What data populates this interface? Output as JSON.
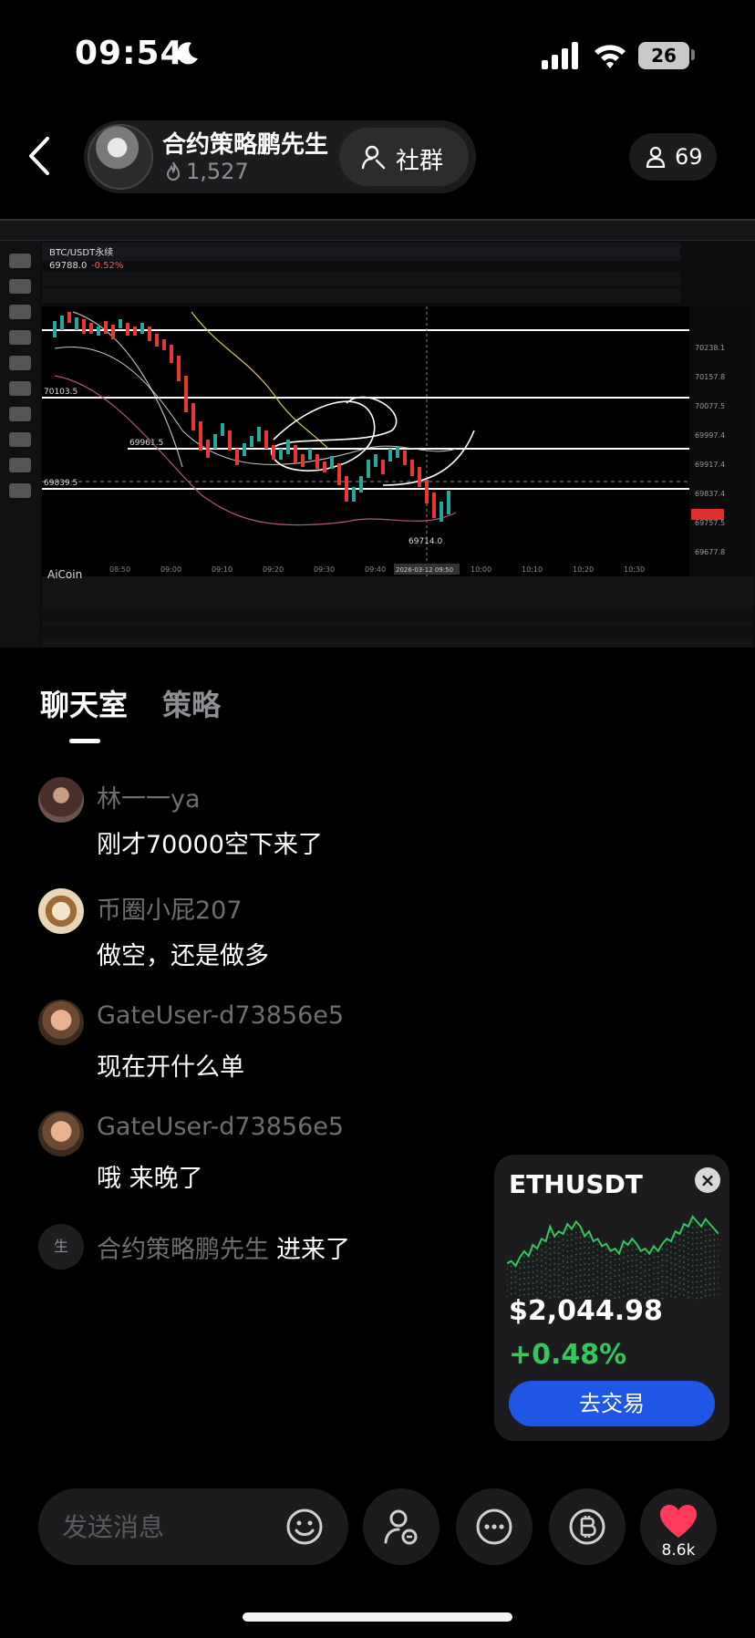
{
  "status_bar": {
    "time": "09:54",
    "battery": "26"
  },
  "header": {
    "host_name": "合约策略鹏先生",
    "host_heat": "1,527",
    "group_label": "社群",
    "viewer_count": "69"
  },
  "chart": {
    "pair": "BTC/USDT永续",
    "last_price": "69788.0",
    "change": "-0.52%",
    "levels": [
      "70103.5",
      "69961.5",
      "69839.5",
      "69714.0"
    ],
    "right_axis": [
      "70238.1",
      "70157.8",
      "70077.5",
      "69997.4",
      "69917.4",
      "69837.4",
      "69757.5",
      "69677.8"
    ],
    "time_labels": [
      "08:50",
      "09:00",
      "09:10",
      "09:20",
      "09:30",
      "09:40",
      "10:00",
      "10:10",
      "10:20",
      "10:30"
    ],
    "cursor_time": "2026-03-12 09:50",
    "brand": "AiCoin"
  },
  "tabs": {
    "chat": "聊天室",
    "strategy": "策略"
  },
  "messages": [
    {
      "user": "林一一ya",
      "text": "刚才70000空下来了"
    },
    {
      "user": "币圈小屁207",
      "text": "做空，还是做多"
    },
    {
      "user": "GateUser-d73856e5",
      "text": "现在开什么单"
    },
    {
      "user": "GateUser-d73856e5",
      "text": "哦 来晚了"
    }
  ],
  "system_message": {
    "avatar_char": "生",
    "user": "合约策略鹏先生",
    "action": "进来了"
  },
  "ticker": {
    "symbol": "ETHUSDT",
    "price": "$2,044.98",
    "change": "+0.48%",
    "button": "去交易",
    "sparkline": [
      40,
      42,
      38,
      45,
      50,
      46,
      55,
      52,
      60,
      58,
      70,
      62,
      66,
      64,
      72,
      68,
      74,
      70,
      62,
      66,
      58,
      60,
      54,
      56,
      50,
      52,
      48,
      58,
      55,
      60,
      56,
      50,
      52,
      48,
      54,
      50,
      56,
      60,
      58,
      66,
      64,
      72,
      70,
      78,
      74,
      70,
      76,
      72,
      68,
      64
    ]
  },
  "composer": {
    "placeholder": "发送消息",
    "like_count": "8.6k"
  },
  "colors": {
    "accent_blue": "#2056e6",
    "up_green": "#34c759",
    "like_red": "#ff3b5c"
  }
}
